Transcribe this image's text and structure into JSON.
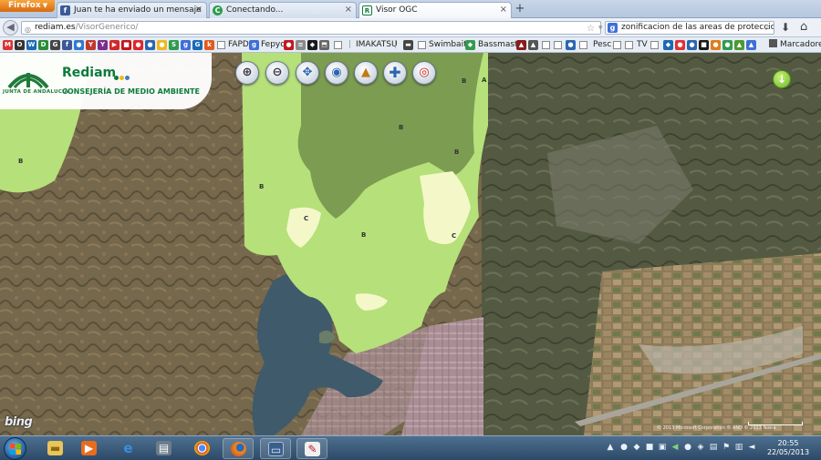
{
  "browser": {
    "menu_button_label": "Firefox",
    "tabs": [
      {
        "title": "Juan te ha enviado un mensaje",
        "favicon": "facebook-icon",
        "active": false
      },
      {
        "title": "Conectando...",
        "favicon": "loading-icon",
        "active": false
      },
      {
        "title": "Visor OGC",
        "favicon": "rediam-favicon",
        "active": true
      }
    ],
    "new_tab_label": "+",
    "url": {
      "host": "rediam.es",
      "path": "/VisorGenerico/"
    },
    "search_text": "zonificacion de las areas de proteccion de l",
    "bookmarks": {
      "labels": [
        "FAPD",
        "Fepyc",
        "IMAKATSU",
        "Swimbaits",
        "Bassmaste",
        "Pesc",
        "TV"
      ],
      "folder_label": "Marcadores"
    }
  },
  "app": {
    "logo_text": "JUNTA DE ANDALUCIA",
    "title": "Rediam",
    "subtitle": "CONSEJERÍA DE MEDIO AMBIENTE",
    "dot_colors": [
      "#0c7a3c",
      "#f2b81b",
      "#3a7fc4"
    ],
    "tools": [
      {
        "name": "zoom-in-icon",
        "glyph": "+"
      },
      {
        "name": "zoom-out-icon",
        "glyph": "−"
      },
      {
        "name": "pan-arrows-icon",
        "glyph": "✥"
      },
      {
        "name": "globe-extent-icon",
        "glyph": "◉"
      },
      {
        "name": "layers-icon",
        "glyph": "▲"
      },
      {
        "name": "add-layer-icon",
        "glyph": "+"
      },
      {
        "name": "help-lifebuoy-icon",
        "glyph": "◎"
      }
    ],
    "zone_labels": [
      "B",
      "B",
      "A",
      "B",
      "C",
      "C",
      "B",
      "B",
      "B"
    ],
    "map_attribution": "© 2013 Microsoft Corporation  © AND  © 2013 Nokia",
    "bing_logo": "bing"
  },
  "colors": {
    "zone_b": "#b6e07a",
    "zone_a": "#7c9c52",
    "zone_c": "#f4f8c8",
    "water": "#3f5a6a"
  },
  "taskbar": {
    "apps": [
      "explorer-folder-icon",
      "media-player-icon",
      "internet-explorer-icon",
      "print-app-icon",
      "chrome-icon",
      "firefox-icon",
      "remote-desktop-icon",
      "paint-icon"
    ],
    "clock_time": "20:55",
    "clock_date": "22/05/2013"
  }
}
